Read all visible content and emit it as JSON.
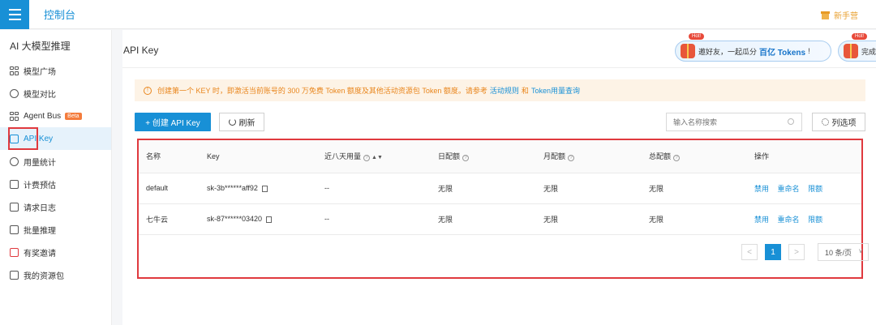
{
  "topbar": {
    "title": "控制台",
    "newbie": "新手营"
  },
  "sidebar": {
    "section_title": "AI 大模型推理",
    "items": [
      {
        "label": "模型广场",
        "icon": "grid-icon"
      },
      {
        "label": "模型对比",
        "icon": "compare-icon"
      },
      {
        "label": "Agent Bus",
        "icon": "grid-icon",
        "badge": "Beta"
      },
      {
        "label": "API Key",
        "icon": "shield-key-icon",
        "active": true
      },
      {
        "label": "用量统计",
        "icon": "pie-chart-icon"
      },
      {
        "label": "计费预估",
        "icon": "document-icon"
      },
      {
        "label": "请求日志",
        "icon": "log-icon"
      },
      {
        "label": "批量推理",
        "icon": "external-icon"
      },
      {
        "label": "有奖邀请",
        "icon": "gift-icon"
      },
      {
        "label": "我的资源包",
        "icon": "external-icon"
      }
    ]
  },
  "page": {
    "title": "API Key"
  },
  "promo": {
    "hot": "Hot!",
    "text_pre": "邀好友，一起瓜分",
    "text_em": "百亿 Tokens",
    "text_post": "!",
    "second_text": "完成"
  },
  "alert": {
    "text": "创建第一个 KEY 时，即激活当前账号的 300 万免费 Token 额度及其他活动资源包 Token 额度。请参考",
    "link1": "活动规则",
    "and": "和",
    "link2": "Token用量查询"
  },
  "toolbar": {
    "create_label": "+ 创建 API Key",
    "refresh_label": "刷新",
    "search_placeholder": "输入名称搜索",
    "columns_label": "列选项"
  },
  "table": {
    "headers": {
      "name": "名称",
      "key": "Key",
      "usage": "近八天用量",
      "daily": "日配额",
      "monthly": "月配额",
      "total": "总配额",
      "actions": "操作"
    },
    "rows": [
      {
        "name": "default",
        "key": "sk-3b******aff92",
        "usage": "--",
        "daily": "无限",
        "monthly": "无限",
        "total": "无限"
      },
      {
        "name": "七牛云",
        "key": "sk-87******03420",
        "usage": "--",
        "daily": "无限",
        "monthly": "无限",
        "total": "无限"
      }
    ],
    "actions": {
      "disable": "禁用",
      "rename": "重命名",
      "limit": "限额"
    }
  },
  "pagination": {
    "prev": "<",
    "current": "1",
    "next": ">",
    "page_size": "10 条/页"
  },
  "colors": {
    "primary": "#1890d6",
    "highlight": "#e0393e",
    "warning": "#e9861d"
  }
}
